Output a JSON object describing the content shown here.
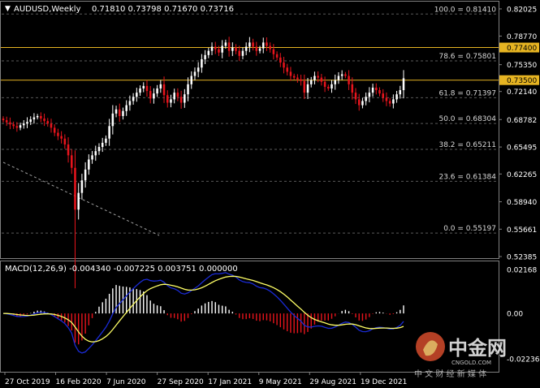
{
  "header": {
    "symbol": "AUDUSD,Weekly",
    "ohlc": "0.71810 0.73798 0.71670 0.73716",
    "menu_glyph": "▼"
  },
  "macd_header": "MACD(12,26,9) -0.004340 -0.007225 0.003751 0.000000",
  "watermark": {
    "brand": "中金网",
    "domain": "CNGOLD.COM",
    "slogan": "中 文 财 经 新 媒 体"
  },
  "colors": {
    "bull": "#ffffff",
    "bear": "#e8141c",
    "level_line": "#e6b422",
    "macd_line": "#1a2bd6",
    "signal_line": "#ffff66",
    "hist_pos": "#ffffff",
    "hist_neg": "#e8141c",
    "grid": "#5a5a5a"
  },
  "chart_data": [
    {
      "type": "candlestick",
      "y_axis_ticks": [
        "0.82025",
        "0.78770",
        "0.75350",
        "0.72140",
        "0.68782",
        "0.65495",
        "0.62265",
        "0.58940",
        "0.55661",
        "0.52385"
      ],
      "ylim": [
        0.5239,
        0.827
      ],
      "x_axis_labels": [
        "27 Oct 2019",
        "16 Feb 2020",
        "7 Jun 2020",
        "27 Sep 2020",
        "17 Jan 2021",
        "9 May 2021",
        "29 Aug 2021",
        "19 Dec 2021"
      ],
      "fibonacci": [
        {
          "label": "100.0 = 0.81410",
          "price": 0.8141
        },
        {
          "label": "78.6 = 0.75801",
          "price": 0.75801
        },
        {
          "label": "61.8 = 0.71397",
          "price": 0.71397
        },
        {
          "label": "50.0 = 0.68304",
          "price": 0.68304
        },
        {
          "label": "38.2 = 0.65211",
          "price": 0.65211
        },
        {
          "label": "23.6 = 0.61384",
          "price": 0.61384
        },
        {
          "label": "0.0 = 0.55197",
          "price": 0.55197
        }
      ],
      "levels": [
        {
          "label": "0.77400",
          "price": 0.774
        },
        {
          "label": "0.73500",
          "price": 0.735
        }
      ],
      "closes": [
        0.687,
        0.6845,
        0.682,
        0.68,
        0.678,
        0.681,
        0.683,
        0.685,
        0.688,
        0.6905,
        0.692,
        0.689,
        0.686,
        0.683,
        0.678,
        0.672,
        0.668,
        0.665,
        0.658,
        0.645,
        0.63,
        0.58,
        0.6,
        0.615,
        0.628,
        0.64,
        0.645,
        0.65,
        0.655,
        0.66,
        0.665,
        0.68,
        0.695,
        0.7,
        0.692,
        0.698,
        0.705,
        0.71,
        0.715,
        0.72,
        0.725,
        0.728,
        0.722,
        0.713,
        0.719,
        0.725,
        0.73,
        0.717,
        0.708,
        0.712,
        0.72,
        0.715,
        0.708,
        0.718,
        0.73,
        0.74,
        0.745,
        0.75,
        0.76,
        0.765,
        0.77,
        0.775,
        0.772,
        0.768,
        0.776,
        0.78,
        0.77,
        0.774,
        0.77,
        0.764,
        0.77,
        0.775,
        0.78,
        0.775,
        0.77,
        0.773,
        0.78,
        0.776,
        0.772,
        0.766,
        0.762,
        0.756,
        0.75,
        0.745,
        0.74,
        0.738,
        0.736,
        0.734,
        0.72,
        0.73,
        0.735,
        0.74,
        0.738,
        0.733,
        0.727,
        0.725,
        0.73,
        0.735,
        0.74,
        0.742,
        0.74,
        0.73,
        0.72,
        0.712,
        0.705,
        0.71,
        0.715,
        0.72,
        0.726,
        0.723,
        0.719,
        0.714,
        0.71,
        0.707,
        0.712,
        0.718,
        0.723,
        0.7372
      ]
    },
    {
      "type": "macd",
      "params": "12,26,9",
      "macd": -0.00434,
      "signal": -0.007225,
      "histogram": 0.003751,
      "y_axis_ticks": [
        "0.02168",
        "0.00",
        "-0.022368"
      ],
      "ylim": [
        -0.028,
        0.0245
      ]
    }
  ]
}
